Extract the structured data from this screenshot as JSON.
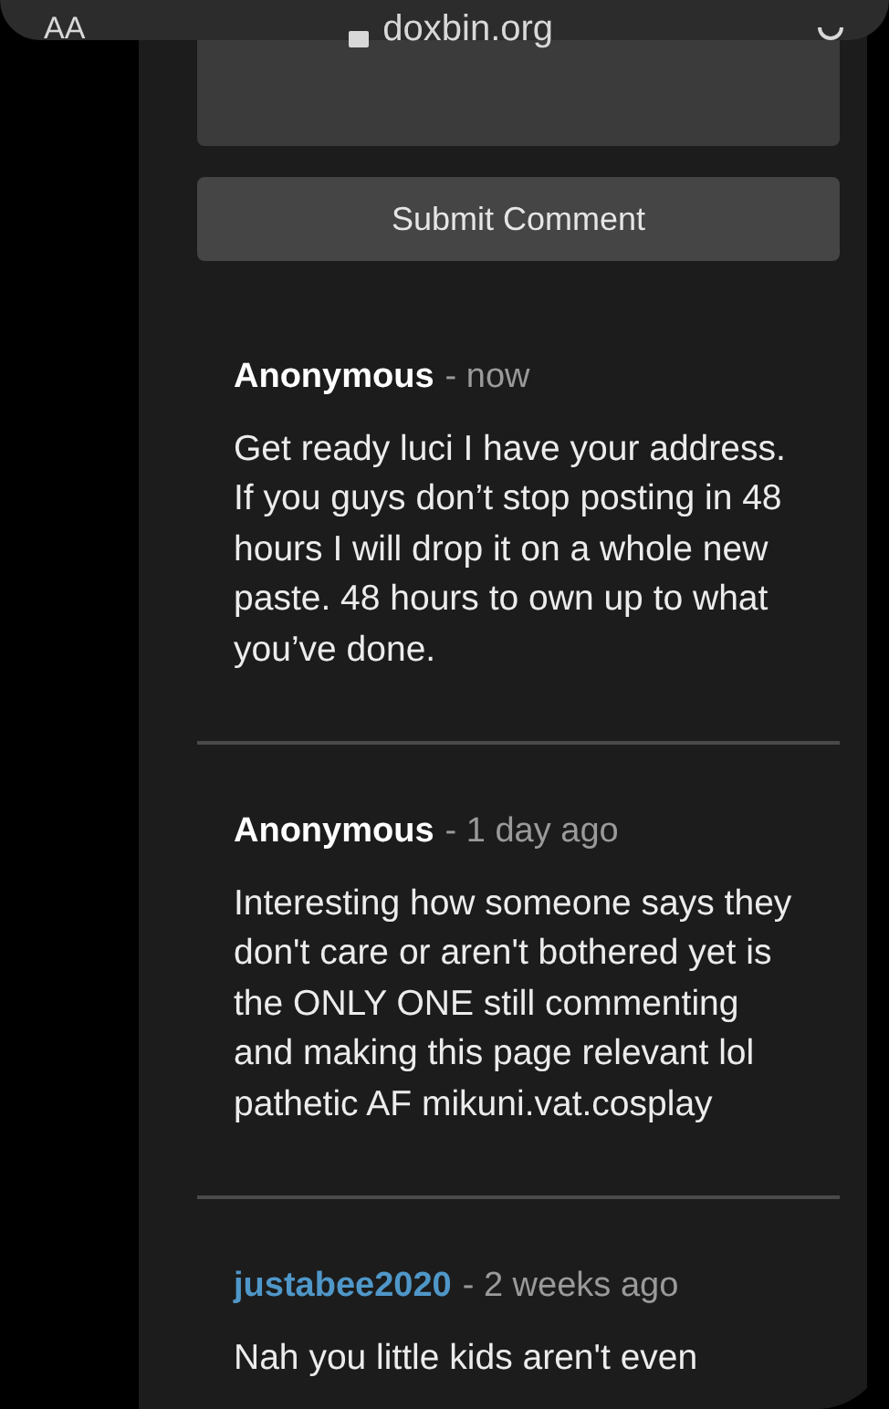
{
  "browser_bar": {
    "reader_label": "AA",
    "url": "doxbin.org"
  },
  "comment_form": {
    "submit_label": "Submit Comment"
  },
  "comments": [
    {
      "author": "Anonymous",
      "kind": "anonymous",
      "time": "- now",
      "body": "Get ready luci I have your address. If you guys don’t stop posting in 48 hours I will drop it on a whole new paste. 48 hours to own up to what you’ve done."
    },
    {
      "author": "Anonymous",
      "kind": "anonymous",
      "time": "- 1 day ago",
      "body": "Interesting how someone says they don't care or aren't bothered yet is the ONLY ONE still commenting and making this page relevant lol pathetic AF mikuni.vat.cosplay"
    },
    {
      "author": "justabee2020",
      "kind": "user",
      "time": "- 2 weeks ago",
      "body": "Nah you little kids aren't even"
    }
  ]
}
